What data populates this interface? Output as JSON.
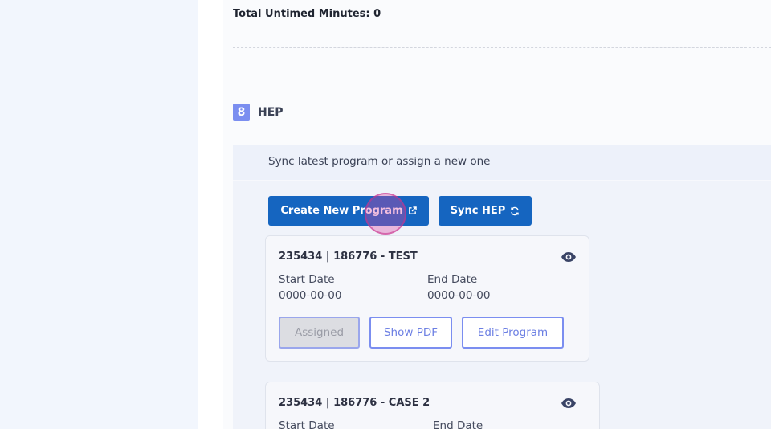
{
  "summary": {
    "total_untimed": "Total Untimed Minutes: 0"
  },
  "section": {
    "number": "8",
    "title": "HEP"
  },
  "hep": {
    "sync_info": "Sync latest program or assign a new one",
    "create_button": "Create New Program",
    "sync_button": "Sync HEP"
  },
  "programs": [
    {
      "title": "235434 | 186776 - TEST",
      "start_label": "Start Date",
      "start_value": "0000-00-00",
      "end_label": "End Date",
      "end_value": "0000-00-00",
      "assigned_label": "Assigned",
      "show_pdf_label": "Show PDF",
      "edit_label": "Edit Program"
    },
    {
      "title": "235434 | 186776 - CASE 2",
      "start_label": "Start Date",
      "end_label": "End Date"
    }
  ],
  "icons": {
    "external_link": "external-link-icon",
    "sync": "sync-icon",
    "eye": "eye-icon"
  },
  "colors": {
    "primary": "#1565c0",
    "accent": "#7b8ef0",
    "left_panel_bg": "#f2f6fd",
    "hep_panel_bg": "#f0f3fa"
  }
}
